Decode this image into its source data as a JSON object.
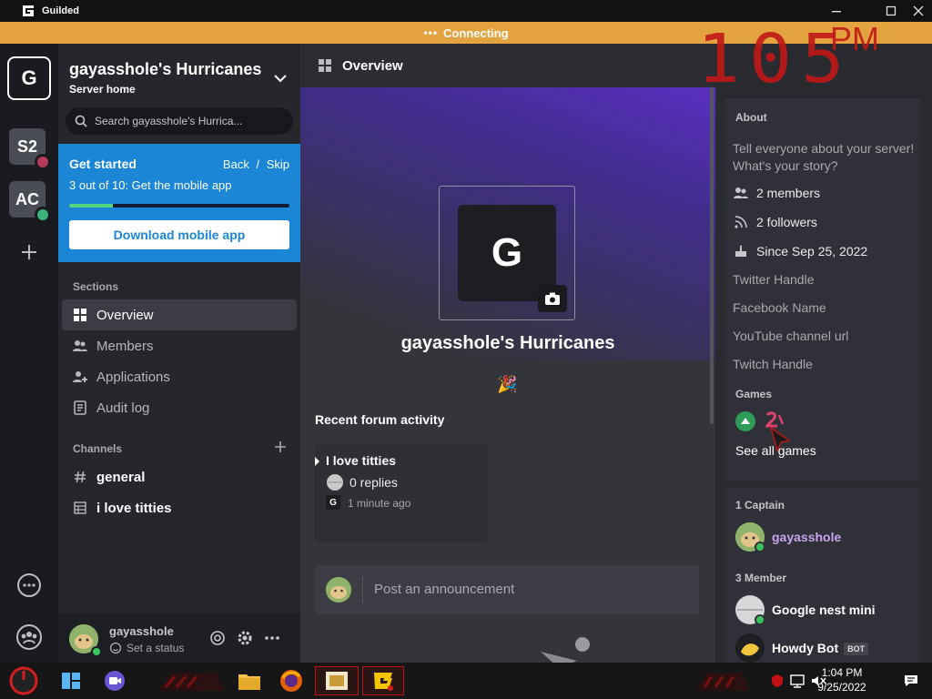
{
  "window": {
    "title": "Guilded"
  },
  "connection": {
    "status": "Connecting",
    "dots": "•••"
  },
  "overlay_clock": {
    "time": "105",
    "ampm": "PM"
  },
  "rail": {
    "active": "G",
    "servers": [
      {
        "label": "S2",
        "dot_color": "#b63a5a"
      },
      {
        "label": "AC",
        "dot_color": "#3bb37a"
      }
    ]
  },
  "sidebar": {
    "server_name": "gayasshole's Hurricanes",
    "server_sub": "Server home",
    "search_placeholder": "Search gayasshole's Hurrica...",
    "get_started": {
      "title": "Get started",
      "back": "Back",
      "sep": "/",
      "skip": "Skip",
      "step": "3 out of 10: Get the mobile app",
      "progress_fraction": 0.2,
      "button": "Download mobile app"
    },
    "sections_header": "Sections",
    "sections": [
      {
        "label": "Overview",
        "active": true
      },
      {
        "label": "Members"
      },
      {
        "label": "Applications"
      },
      {
        "label": "Audit log"
      }
    ],
    "channels_header": "Channels",
    "channels": [
      {
        "label": "general"
      },
      {
        "label": "i love titties"
      }
    ]
  },
  "user": {
    "name": "gayasshole",
    "status": "Set a status"
  },
  "main": {
    "header": "Overview",
    "logo_letter": "G",
    "server_title": "gayasshole's Hurricanes",
    "emoji": "🎉",
    "recent_header": "Recent forum activity",
    "forum": {
      "title": "I love titties",
      "replies": "0 replies",
      "ago": "1 minute ago",
      "author_initial": "G"
    },
    "announce_placeholder": "Post an announcement"
  },
  "about": {
    "header": "About",
    "text": "Tell everyone about your server! What's your story?",
    "members": "2 members",
    "followers": "2 followers",
    "since": "Since Sep 25, 2022",
    "twitter": "Twitter Handle",
    "facebook": "Facebook Name",
    "youtube": "YouTube channel url",
    "twitch": "Twitch Handle",
    "games_header": "Games",
    "see_all": "See all games"
  },
  "members_panel": {
    "captain_header": "1 Captain",
    "captain": {
      "name": "gayasshole",
      "color": "#c9a4f0"
    },
    "member_header": "3 Member",
    "members": [
      {
        "name": "Google nest mini",
        "bot": false
      },
      {
        "name": "Howdy Bot",
        "bot": true,
        "badge": "BOT"
      }
    ]
  },
  "taskbar": {
    "time": "1:04 PM",
    "date": "9/25/2022"
  },
  "colors": {
    "accent": "#1b86d6",
    "connecting": "#e3a33f",
    "online": "#3bc35f"
  }
}
